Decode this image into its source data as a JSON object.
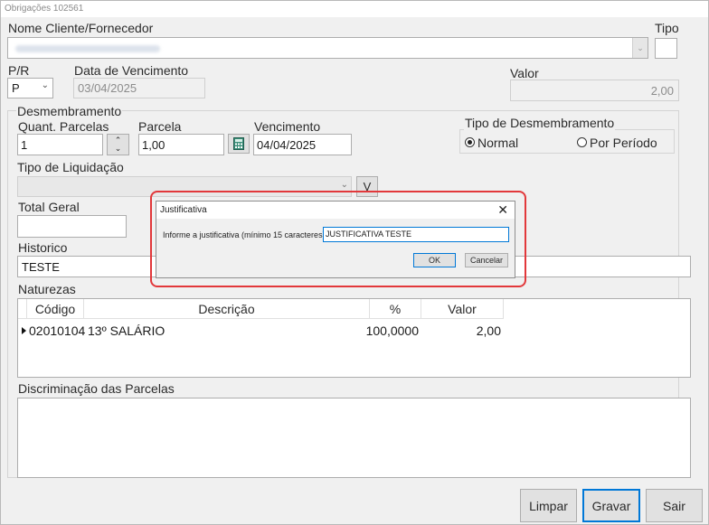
{
  "window": {
    "title": "Obrigações 102561"
  },
  "header": {
    "cliente_label": "Nome Cliente/Fornecedor",
    "tipo_label": "Tipo",
    "pr_label": "P/R",
    "pr_value": "P",
    "data_venc_label": "Data de Vencimento",
    "data_venc_value": "03/04/2025",
    "valor_label": "Valor",
    "valor_value": "2,00"
  },
  "desmembramento": {
    "group_label": "Desmembramento",
    "quant_label": "Quant. Parcelas",
    "quant_value": "1",
    "parcela_label": "Parcela",
    "parcela_value": "1,00",
    "vencimento_label": "Vencimento",
    "vencimento_value": "04/04/2025",
    "tipo_group_label": "Tipo de Desmembramento",
    "normal_label": "Normal",
    "periodo_label": "Por Período",
    "selected": "Normal"
  },
  "liquidacao": {
    "label": "Tipo de Liquidação",
    "button": "V"
  },
  "total": {
    "label": "Total Geral"
  },
  "historico": {
    "label": "Historico",
    "value": "TESTE"
  },
  "naturezas": {
    "label": "Naturezas",
    "columns": [
      "Código",
      "Descrição",
      "%",
      "Valor"
    ],
    "rows": [
      {
        "codigo": "02010104",
        "descricao": "13º SALÁRIO",
        "percent": "100,0000",
        "valor": "2,00"
      }
    ]
  },
  "discriminacao": {
    "label": "Discriminação das Parcelas"
  },
  "buttons": {
    "limpar": "Limpar",
    "gravar": "Gravar",
    "sair": "Sair"
  },
  "dialog": {
    "title": "Justificativa",
    "prompt": "Informe a justificativa (mínimo 15 caracteres):",
    "input_value": "JUSTIFICATIVA TESTE",
    "ok": "OK",
    "cancel": "Cancelar"
  },
  "colors": {
    "highlight": "#e2383b",
    "primary_border": "#0078d7"
  }
}
